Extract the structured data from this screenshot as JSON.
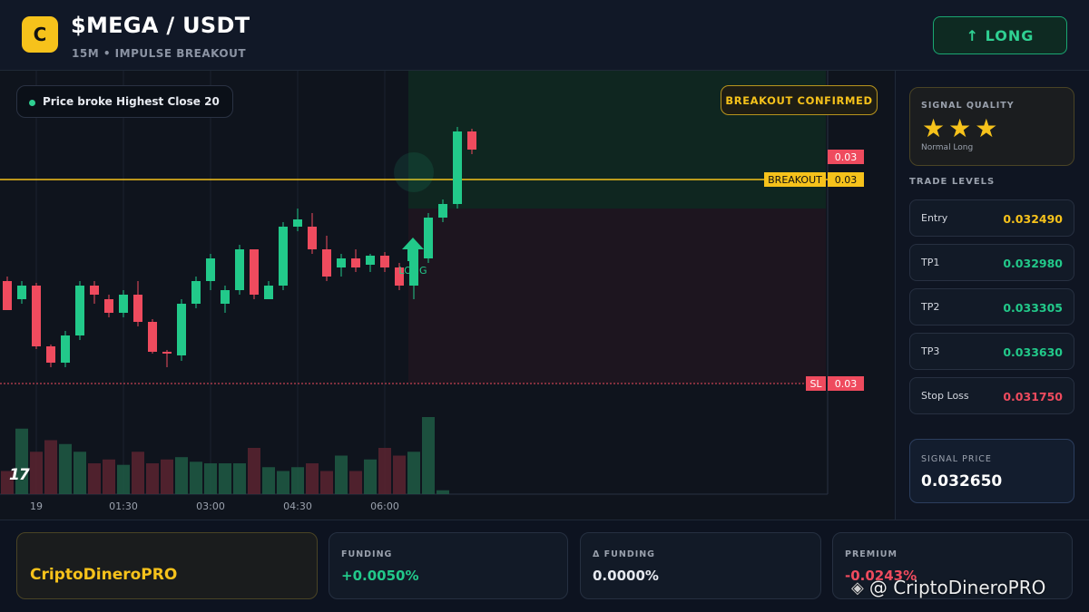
{
  "header": {
    "logo_letter": "C",
    "title": "$MEGA / USDT",
    "subtitle": "15M • IMPULSE BREAKOUT",
    "action_label": "↑ LONG"
  },
  "chart": {
    "info_chip": "Price broke Highest Close 20",
    "badge": "BREAKOUT CONFIRMED",
    "breakout_label": "BREAKOUT",
    "breakout_value": "0.03",
    "tp_value": "0.03",
    "sl_label": "SL",
    "sl_value": "0.03",
    "signal_label": "LONG",
    "time_labels": [
      "19",
      "01:30",
      "03:00",
      "04:30",
      "06:00"
    ],
    "tv_logo": "17",
    "colors": {
      "up": "#22c98a",
      "down": "#ef4b5e",
      "breakout": "#f6c21b",
      "sl": "#ef4b5e"
    }
  },
  "chart_data": {
    "type": "candlestick",
    "candles": [
      {
        "o": 0.0316,
        "h": 0.03165,
        "l": 0.0313,
        "c": 0.03128
      },
      {
        "o": 0.0314,
        "h": 0.0316,
        "l": 0.03135,
        "c": 0.03155
      },
      {
        "o": 0.03155,
        "h": 0.03158,
        "l": 0.03085,
        "c": 0.03088
      },
      {
        "o": 0.03088,
        "h": 0.0309,
        "l": 0.03065,
        "c": 0.0307
      },
      {
        "o": 0.0307,
        "h": 0.03105,
        "l": 0.03065,
        "c": 0.031
      },
      {
        "o": 0.031,
        "h": 0.0316,
        "l": 0.03095,
        "c": 0.03155
      },
      {
        "o": 0.03155,
        "h": 0.0316,
        "l": 0.03135,
        "c": 0.03145
      },
      {
        "o": 0.0314,
        "h": 0.03145,
        "l": 0.0312,
        "c": 0.03125
      },
      {
        "o": 0.03125,
        "h": 0.0315,
        "l": 0.0312,
        "c": 0.03145
      },
      {
        "o": 0.03145,
        "h": 0.0316,
        "l": 0.0311,
        "c": 0.03115
      },
      {
        "o": 0.03115,
        "h": 0.03118,
        "l": 0.0308,
        "c": 0.03082
      },
      {
        "o": 0.03082,
        "h": 0.03084,
        "l": 0.03065,
        "c": 0.0308
      },
      {
        "o": 0.03078,
        "h": 0.0314,
        "l": 0.03072,
        "c": 0.03135
      },
      {
        "o": 0.03135,
        "h": 0.03165,
        "l": 0.0313,
        "c": 0.0316
      },
      {
        "o": 0.0316,
        "h": 0.0319,
        "l": 0.0315,
        "c": 0.03185
      },
      {
        "o": 0.03135,
        "h": 0.03155,
        "l": 0.03125,
        "c": 0.0315
      },
      {
        "o": 0.0315,
        "h": 0.032,
        "l": 0.03145,
        "c": 0.03195
      },
      {
        "o": 0.03195,
        "h": 0.03185,
        "l": 0.0314,
        "c": 0.03145
      },
      {
        "o": 0.0314,
        "h": 0.0316,
        "l": 0.0314,
        "c": 0.03155
      },
      {
        "o": 0.03155,
        "h": 0.03225,
        "l": 0.0315,
        "c": 0.0322
      },
      {
        "o": 0.0322,
        "h": 0.0324,
        "l": 0.03215,
        "c": 0.03228
      },
      {
        "o": 0.0322,
        "h": 0.03235,
        "l": 0.0319,
        "c": 0.03195
      },
      {
        "o": 0.03195,
        "h": 0.0321,
        "l": 0.0316,
        "c": 0.03165
      },
      {
        "o": 0.03175,
        "h": 0.0319,
        "l": 0.03165,
        "c": 0.03185
      },
      {
        "o": 0.03185,
        "h": 0.03195,
        "l": 0.0317,
        "c": 0.03175
      },
      {
        "o": 0.03178,
        "h": 0.0319,
        "l": 0.0317,
        "c": 0.03188
      },
      {
        "o": 0.03188,
        "h": 0.03192,
        "l": 0.0317,
        "c": 0.03175
      },
      {
        "o": 0.03175,
        "h": 0.0318,
        "l": 0.0315,
        "c": 0.03155
      },
      {
        "o": 0.03155,
        "h": 0.0319,
        "l": 0.0314,
        "c": 0.03185
      },
      {
        "o": 0.03185,
        "h": 0.03235,
        "l": 0.0318,
        "c": 0.0323
      },
      {
        "o": 0.0323,
        "h": 0.0325,
        "l": 0.03225,
        "c": 0.03245
      },
      {
        "o": 0.03245,
        "h": 0.0333,
        "l": 0.0324,
        "c": 0.03325
      },
      {
        "o": 0.03325,
        "h": 0.03328,
        "l": 0.033,
        "c": 0.03305
      }
    ],
    "volume": [
      30,
      85,
      55,
      70,
      65,
      55,
      40,
      45,
      38,
      55,
      40,
      45,
      48,
      42,
      40,
      40,
      40,
      60,
      35,
      30,
      35,
      40,
      30,
      50,
      30,
      45,
      60,
      50,
      55,
      100,
      5
    ],
    "levels": {
      "breakout": 0.0324,
      "sl": 0.03175,
      "tp": 0.0329
    }
  },
  "sidebar": {
    "quality_label": "SIGNAL QUALITY",
    "stars": "★★★",
    "quality_note": "Normal Long",
    "levels_title": "TRADE LEVELS",
    "levels": [
      {
        "name": "Entry",
        "value": "0.032490",
        "color": "#f6c21b"
      },
      {
        "name": "TP1",
        "value": "0.032980",
        "color": "#22c98a"
      },
      {
        "name": "TP2",
        "value": "0.033305",
        "color": "#22c98a"
      },
      {
        "name": "TP3",
        "value": "0.033630",
        "color": "#22c98a"
      },
      {
        "name": "Stop Loss",
        "value": "0.031750",
        "color": "#ef4b5e"
      }
    ],
    "signal_label": "SIGNAL PRICE",
    "signal_value": "0.032650"
  },
  "footer": {
    "brand": "CriptoDineroPRO",
    "stats": [
      {
        "label": "FUNDING",
        "value": "+0.0050%",
        "color": "#22c98a"
      },
      {
        "label": "Δ FUNDING",
        "value": "0.0000%",
        "color": "#e6e9ef"
      },
      {
        "label": "PREMIUM",
        "value": "-0.0243%",
        "color": "#ef4b5e"
      }
    ],
    "watermark": "@ CriptoDineroPRO"
  }
}
